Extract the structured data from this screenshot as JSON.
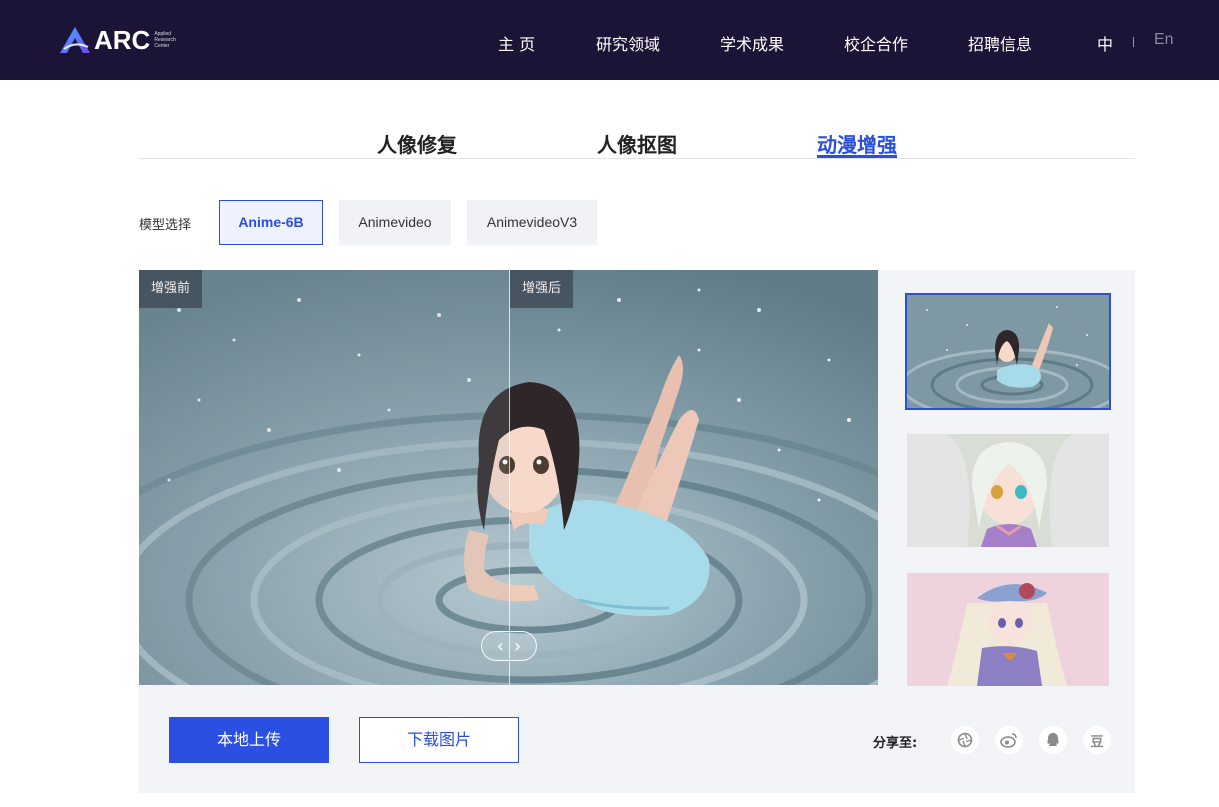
{
  "header": {
    "logo": {
      "text": "ARC",
      "sub": "Applied Research Center"
    },
    "nav": [
      {
        "label": "主 页"
      },
      {
        "label": "研究领域"
      },
      {
        "label": "学术成果"
      },
      {
        "label": "校企合作"
      },
      {
        "label": "招聘信息"
      }
    ],
    "lang": {
      "zh": "中",
      "en": "En"
    }
  },
  "tabs": [
    {
      "label": "人像修复",
      "active": false
    },
    {
      "label": "人像抠图",
      "active": false
    },
    {
      "label": "动漫增强",
      "active": true
    }
  ],
  "model": {
    "label": "模型选择",
    "options": [
      {
        "label": "Anime-6B",
        "selected": true
      },
      {
        "label": "Animevideo",
        "selected": false
      },
      {
        "label": "AnimevideoV3",
        "selected": false
      }
    ]
  },
  "compare": {
    "before_label": "增强前",
    "after_label": "增强后"
  },
  "thumbnails": [
    {
      "name": "girl-in-water",
      "selected": true
    },
    {
      "name": "white-hair-girl",
      "selected": false
    },
    {
      "name": "girl-with-hat",
      "selected": false
    }
  ],
  "actions": {
    "upload": "本地上传",
    "download": "下载图片"
  },
  "share": {
    "label": "分享至:",
    "icons": [
      "aperture-icon",
      "weibo-icon",
      "qq-icon",
      "douban-icon"
    ],
    "douban_glyph": "豆"
  },
  "colors": {
    "header_bg": "#1c1436",
    "accent": "#2b4fd8",
    "panel_bg": "#f2f4f8"
  }
}
